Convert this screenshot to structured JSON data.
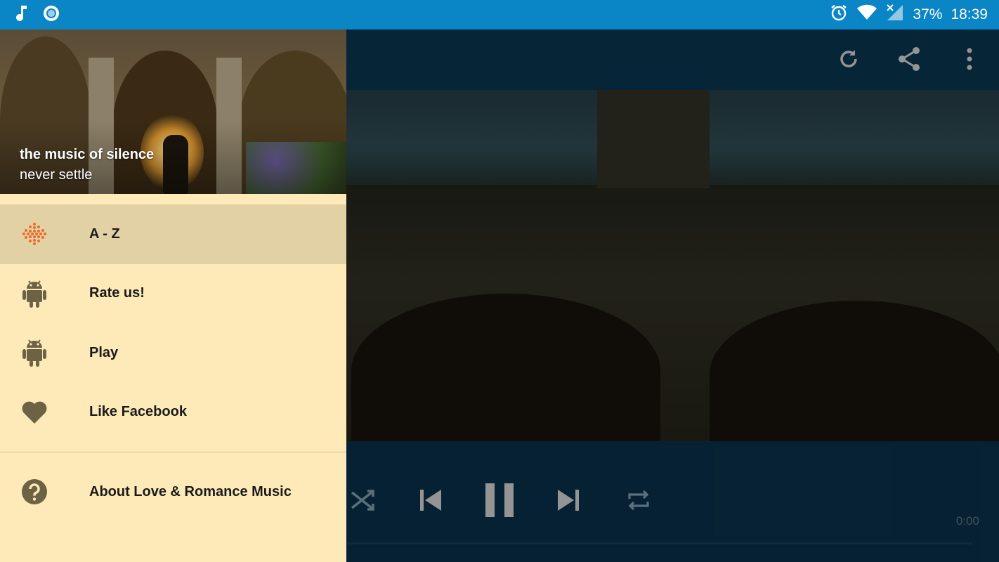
{
  "status_bar": {
    "battery": "37%",
    "time": "18:39"
  },
  "drawer": {
    "header": {
      "title": "the music of silence",
      "subtitle": "never settle"
    },
    "menu": [
      {
        "label": "A - Z",
        "icon": "equalizer-dots-icon",
        "active": true
      },
      {
        "label": "Rate us!",
        "icon": "android-icon"
      },
      {
        "label": "Play",
        "icon": "android-icon"
      },
      {
        "label": "Like Facebook",
        "icon": "heart-icon"
      }
    ],
    "about": {
      "label": "About Love & Romance Music",
      "icon": "help-circle-icon"
    }
  },
  "player": {
    "elapsed": "0:00"
  },
  "colors": {
    "status_bar": "#0a86c6",
    "toolbar": "#0b4160",
    "drawer_bg": "#feeab8",
    "active_item": "#e2d1a5",
    "accent": "#ee6a2a"
  }
}
